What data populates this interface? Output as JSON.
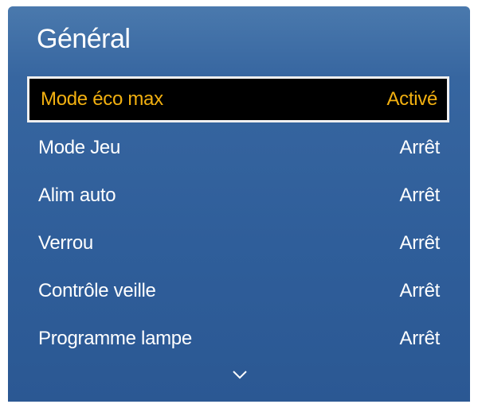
{
  "menu": {
    "title": "Général",
    "items": [
      {
        "label": "Mode éco max",
        "value": "Activé",
        "selected": true
      },
      {
        "label": "Mode Jeu",
        "value": "Arrêt"
      },
      {
        "label": "Alim auto",
        "value": "Arrêt"
      },
      {
        "label": "Verrou",
        "value": "Arrêt"
      },
      {
        "label": "Contrôle veille",
        "value": "Arrêt"
      },
      {
        "label": "Programme lampe",
        "value": "Arrêt"
      }
    ],
    "scroll_indicator": "chevron-down-icon"
  },
  "colors": {
    "panel_top": "#4a79ad",
    "panel_bottom": "#2b5893",
    "selected_background": "#000000",
    "selected_text": "#f2b010",
    "text": "#ffffff"
  }
}
